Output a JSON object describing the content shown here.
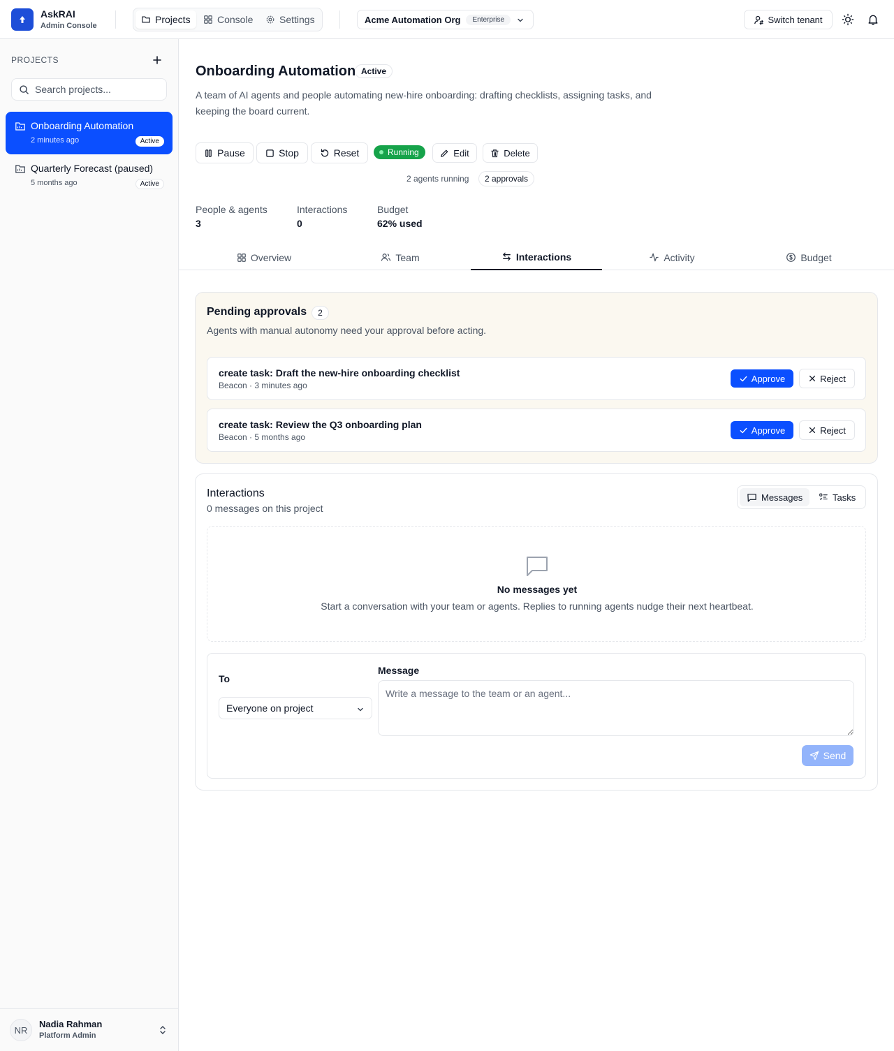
{
  "app": {
    "name": "AskRAI",
    "subtitle": "Admin Console"
  },
  "nav": {
    "projects": "Projects",
    "console": "Console",
    "settings": "Settings"
  },
  "tenant": {
    "name": "Acme Automation Org",
    "plan": "Enterprise",
    "switch_label": "Switch tenant"
  },
  "sidebar": {
    "heading": "PROJECTS",
    "search_placeholder": "Search projects...",
    "projects": [
      {
        "name": "Onboarding Automation",
        "time": "2 minutes ago",
        "badge": "Active",
        "selected": true
      },
      {
        "name": "Quarterly Forecast (paused)",
        "time": "5 months ago",
        "badge": "Active",
        "selected": false
      }
    ],
    "user": {
      "initials": "NR",
      "name": "Nadia Rahman",
      "role": "Platform Admin"
    }
  },
  "project": {
    "title": "Onboarding Automation",
    "status": "Active",
    "description": "A team of AI agents and people automating new-hire onboarding: drafting checklists, assigning tasks, and keeping the board current.",
    "actions": {
      "pause": "Pause",
      "stop": "Stop",
      "reset": "Reset",
      "running": "Running",
      "edit": "Edit",
      "delete": "Delete"
    },
    "agents_running": "2 agents running",
    "approvals_pill": "2 approvals",
    "stats": [
      {
        "label": "People & agents",
        "value": "3"
      },
      {
        "label": "Interactions",
        "value": "0"
      },
      {
        "label": "Budget",
        "value": "62% used"
      }
    ],
    "budget_used_fraction": 0.62
  },
  "tabs": [
    {
      "label": "Overview",
      "icon": "grid-icon"
    },
    {
      "label": "Team",
      "icon": "users-icon"
    },
    {
      "label": "Interactions",
      "icon": "arrows-icon",
      "active": true
    },
    {
      "label": "Activity",
      "icon": "activity-icon"
    },
    {
      "label": "Budget",
      "icon": "dollar-icon"
    }
  ],
  "approvals": {
    "title": "Pending approvals",
    "count": "2",
    "subtitle": "Agents with manual autonomy need your approval before acting.",
    "approve_label": "Approve",
    "reject_label": "Reject",
    "items": [
      {
        "title": "create task: Draft the new-hire onboarding checklist",
        "meta": "Beacon · 3 minutes ago"
      },
      {
        "title": "create task: Review the Q3 onboarding plan",
        "meta": "Beacon · 5 months ago"
      }
    ]
  },
  "interactions": {
    "title": "Interactions",
    "subtitle": "0 messages on this project",
    "toggle": {
      "messages": "Messages",
      "tasks": "Tasks"
    },
    "empty_title": "No messages yet",
    "empty_text": "Start a conversation with your team or agents. Replies to running agents nudge their next heartbeat.",
    "to_label": "To",
    "to_value": "Everyone on project",
    "message_label": "Message",
    "message_placeholder": "Write a message to the team or an agent...",
    "send_label": "Send"
  },
  "colors": {
    "accent": "#0b4fff",
    "running": "#16a34a",
    "approvals_bg": "#fbf8f0"
  }
}
